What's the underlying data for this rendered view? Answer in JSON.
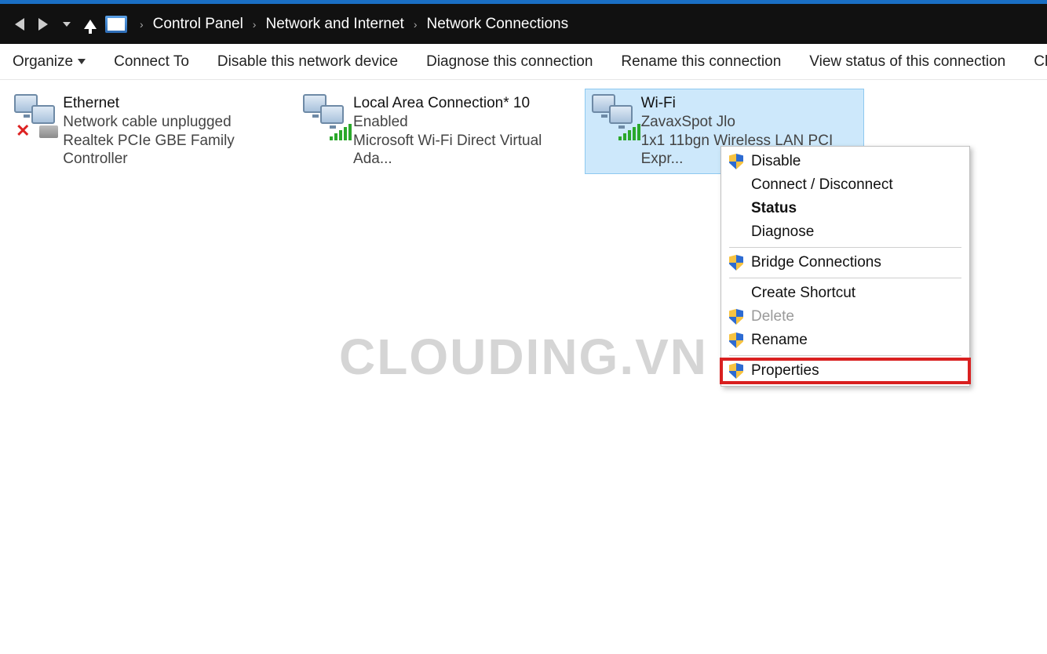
{
  "breadcrumb": {
    "seg0": "Control Panel",
    "seg1": "Network and Internet",
    "seg2": "Network Connections"
  },
  "toolbar": {
    "organize": "Organize",
    "connect_to": "Connect To",
    "disable": "Disable this network device",
    "diagnose": "Diagnose this connection",
    "rename": "Rename this connection",
    "view_status": "View status of this connection",
    "change_settings": "Change setti"
  },
  "connections": [
    {
      "name": "Ethernet",
      "status": "Network cable unplugged",
      "device": "Realtek PCIe GBE Family Controller",
      "selected": false,
      "signal": false,
      "error": true
    },
    {
      "name": "Local Area Connection* 10",
      "status": "Enabled",
      "device": "Microsoft Wi-Fi Direct Virtual Ada...",
      "selected": false,
      "signal": true,
      "error": false
    },
    {
      "name": "Wi-Fi",
      "status": "ZavaxSpot Jlo",
      "device": "1x1 11bgn Wireless LAN PCI Expr...",
      "selected": true,
      "signal": true,
      "error": false
    }
  ],
  "context_menu": {
    "disable": "Disable",
    "connect_disconnect": "Connect / Disconnect",
    "status": "Status",
    "diagnose": "Diagnose",
    "bridge": "Bridge Connections",
    "create_shortcut": "Create Shortcut",
    "delete": "Delete",
    "rename": "Rename",
    "properties": "Properties"
  },
  "watermark": "CLOUDING.VN"
}
